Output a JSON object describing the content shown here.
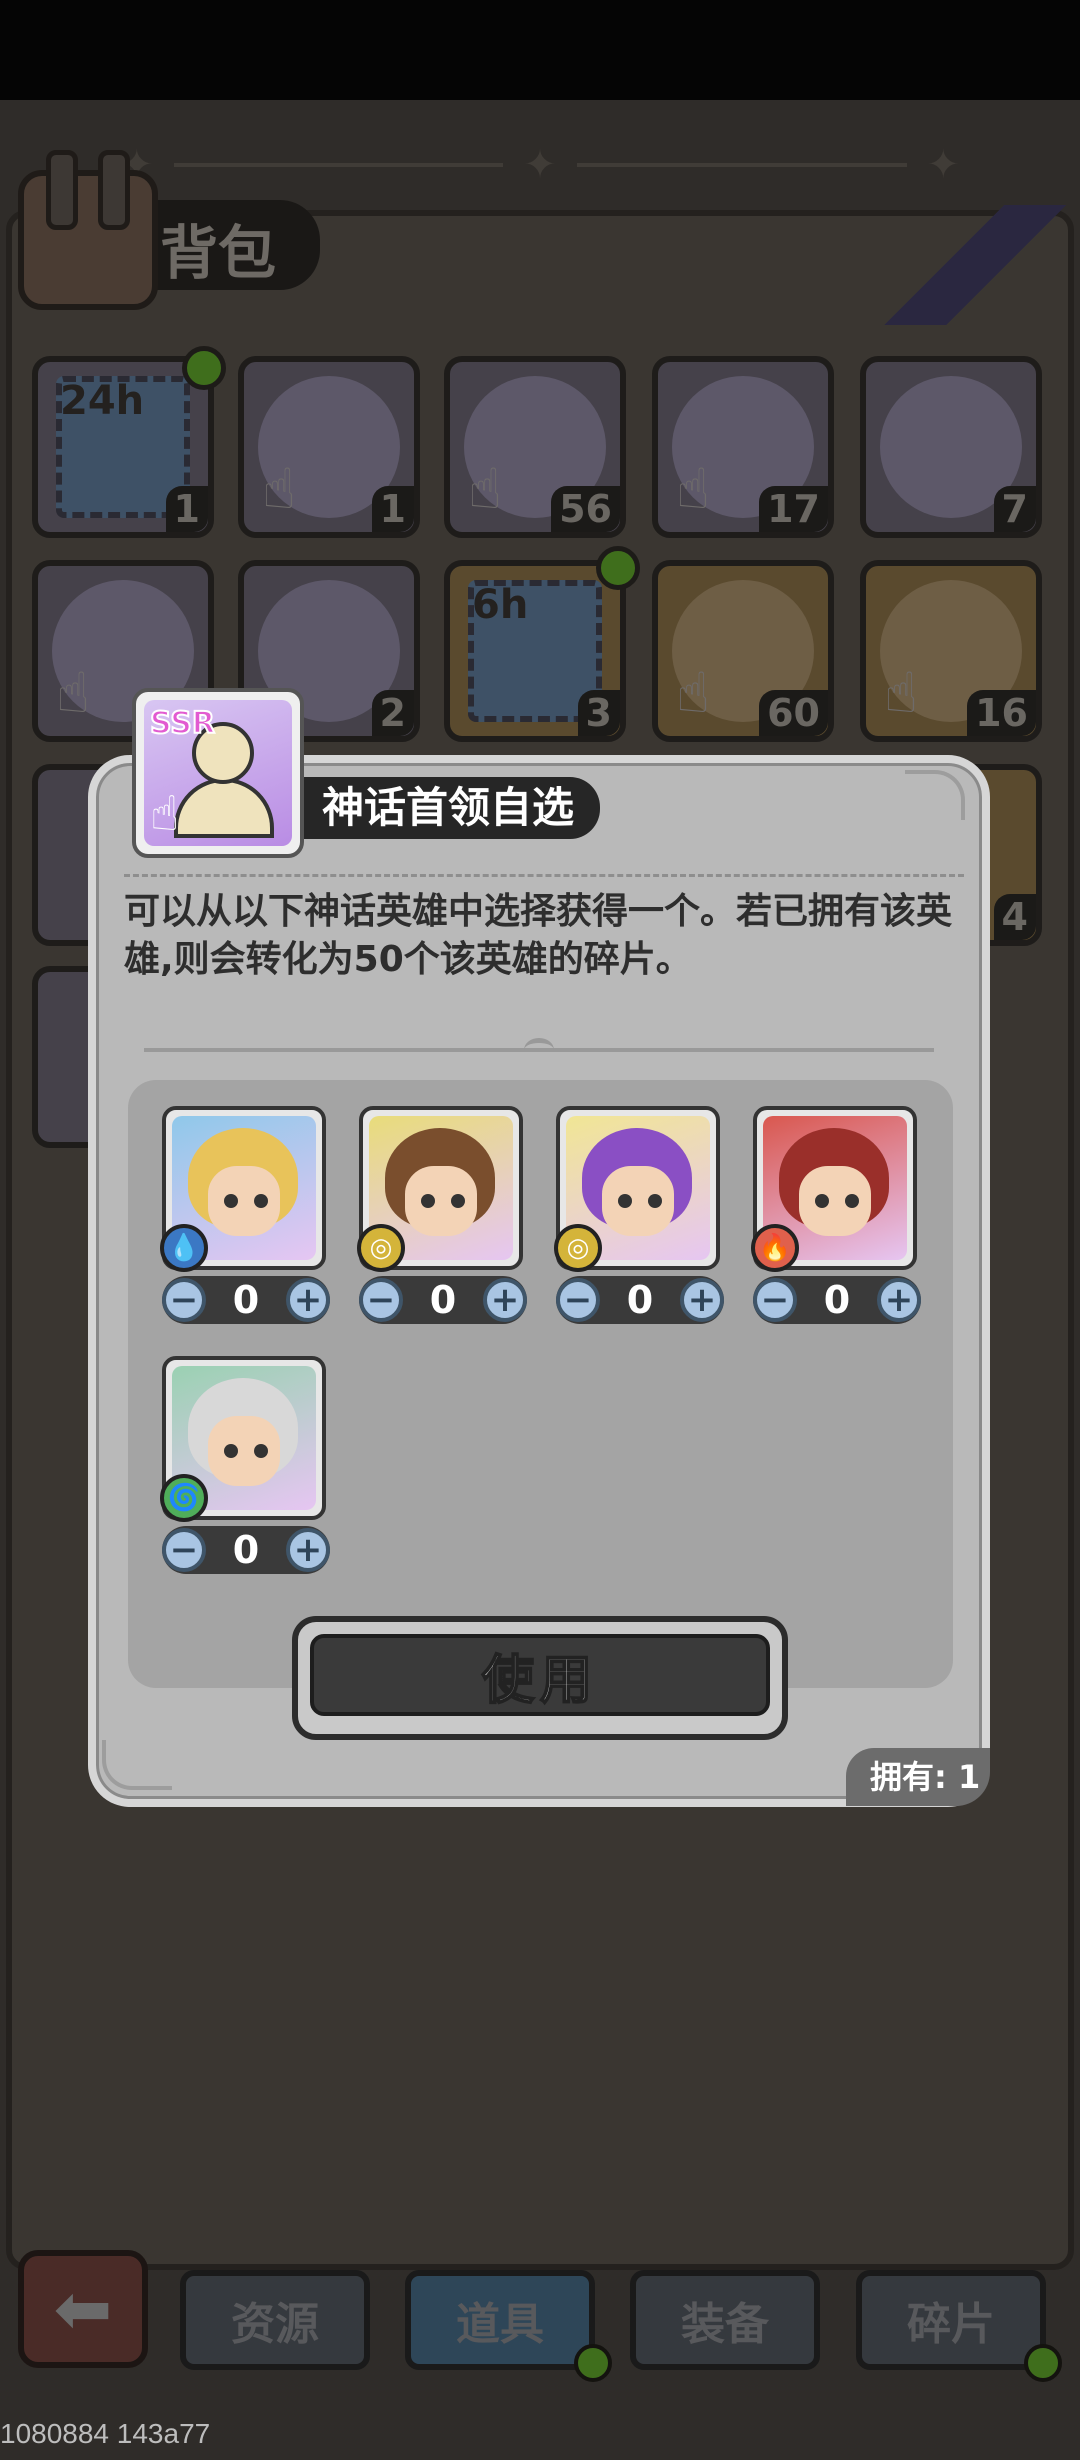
{
  "background": {
    "bag_title": "背包",
    "grid_items": [
      {
        "count": "1",
        "label": "24h"
      },
      {
        "count": "1",
        "label": ""
      },
      {
        "count": "56",
        "label": ""
      },
      {
        "count": "17",
        "label": ""
      },
      {
        "count": "7",
        "label": ""
      },
      {
        "count": "",
        "label": ""
      },
      {
        "count": "2",
        "label": ""
      },
      {
        "count": "3",
        "label": "6h"
      },
      {
        "count": "60",
        "label": ""
      },
      {
        "count": "16",
        "label": ""
      },
      {
        "count": "4",
        "label": ""
      }
    ],
    "nav_tabs": [
      "资源",
      "道具",
      "装备",
      "碎片"
    ],
    "active_tab": "道具"
  },
  "modal": {
    "title": "神话首领自选",
    "icon_badge": "SSR",
    "description": "可以从以下神话英雄中选择获得一个。若已拥有该英雄,则会转化为50个该英雄的碎片。",
    "heroes": [
      {
        "quantity": "0",
        "element": "water",
        "hair_color": "#e8c35a",
        "bg": "#8fc8ea"
      },
      {
        "quantity": "0",
        "element": "earth",
        "hair_color": "#7a4e2d",
        "bg": "#e8dc7a"
      },
      {
        "quantity": "0",
        "element": "earth",
        "hair_color": "#8a4fc4",
        "bg": "#f1e694"
      },
      {
        "quantity": "0",
        "element": "fire",
        "hair_color": "#9a2f2a",
        "bg": "#d9574e"
      },
      {
        "quantity": "0",
        "element": "wind",
        "hair_color": "#d8d8d8",
        "bg": "#9ad1b2"
      }
    ],
    "use_button": "使用",
    "owned": "拥有: 1"
  },
  "debug_text": "1080884 143a77",
  "colors": {
    "modal_bg": "#b9b9b9",
    "panel_bg": "#a4a4a4",
    "title_bar": "#262626",
    "stepper_btn": "#a9c5e3",
    "water": "#3b78c4",
    "earth": "#d4b43a",
    "fire": "#e0604c",
    "wind": "#4fae5a"
  }
}
